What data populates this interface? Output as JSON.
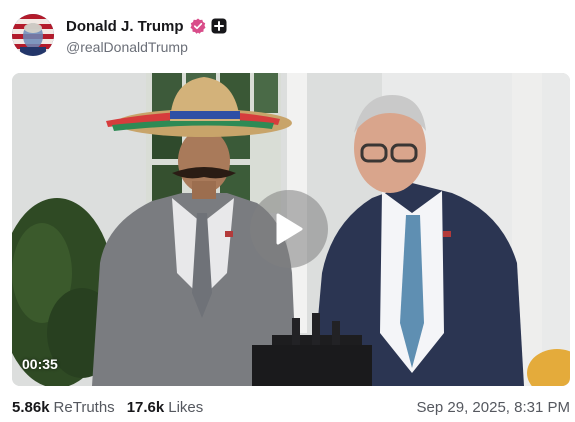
{
  "author": {
    "display_name": "Donald J. Trump",
    "handle": "@realDonaldTrump",
    "avatar_icon": "flag-portrait-avatar",
    "verified_icon": "verified-check-icon",
    "plus_icon": "plus-badge-icon",
    "verified_color": "#d94d8a"
  },
  "video": {
    "duration": "00:35",
    "play_icon": "play-icon"
  },
  "stats": {
    "retruths_count": "5.86k",
    "retruths_label": "ReTruths",
    "likes_count": "17.6k",
    "likes_label": "Likes"
  },
  "timestamp": "Sep 29, 2025, 8:31 PM"
}
